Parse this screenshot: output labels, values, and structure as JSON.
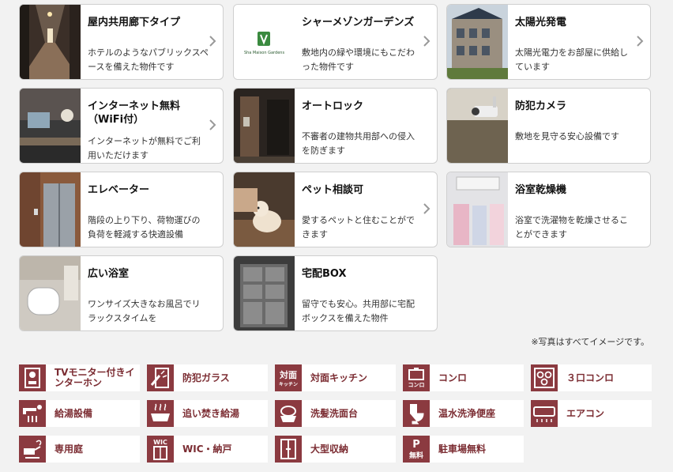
{
  "cards": [
    {
      "title": "屋内共用廊下タイプ",
      "desc": "ホテルのようなパブリックスペースを備えた物件です",
      "icon": "hallway-photo",
      "has_link": true
    },
    {
      "title": "シャーメゾンガーデンズ",
      "desc": "敷地内の緑や環境にもこだわった物件です",
      "icon": "shamaison-gardens-logo",
      "logo_text": "Sha Maison Gardens",
      "has_link": true
    },
    {
      "title": "太陽光発電",
      "desc": "太陽光電力をお部屋に供給しています",
      "icon": "solar-building-photo",
      "has_link": true
    },
    {
      "title": "インターネット無料（WiFi付）",
      "desc": "インターネットが無料でご利用いただけます",
      "icon": "lounge-photo",
      "has_link": true
    },
    {
      "title": "オートロック",
      "desc": "不審者の建物共用部への侵入を防ぎます",
      "icon": "entrance-photo",
      "has_link": false
    },
    {
      "title": "防犯カメラ",
      "desc": "敷地を見守る安心設備です",
      "icon": "security-camera-photo",
      "has_link": false
    },
    {
      "title": "エレベーター",
      "desc": "階段の上り下り、荷物運びの負荷を軽減する快適設備",
      "icon": "elevator-photo",
      "has_link": false
    },
    {
      "title": "ペット相談可",
      "desc": "愛するペットと住むことができます",
      "icon": "pet-dog-photo",
      "has_link": true
    },
    {
      "title": "浴室乾燥機",
      "desc": "浴室で洗濯物を乾燥させることができます",
      "icon": "bathroom-dryer-photo",
      "has_link": false
    },
    {
      "title": "広い浴室",
      "desc": "ワンサイズ大きなお風呂でリラックスタイムを",
      "icon": "bathtub-photo",
      "has_link": false
    },
    {
      "title": "宅配BOX",
      "desc": "留守でも安心。共用部に宅配ボックスを備えた物件",
      "icon": "delivery-box-photo",
      "has_link": false
    }
  ],
  "note": "※写真はすべてイメージです。",
  "amenities": [
    {
      "label": "TVモニター付きインターホン",
      "icon": "intercom-icon"
    },
    {
      "label": "防犯ガラス",
      "icon": "security-glass-icon"
    },
    {
      "label": "対面キッチン",
      "icon": "counter-kitchen-icon",
      "icon_text": [
        "対面",
        "キッチン"
      ]
    },
    {
      "label": "コンロ",
      "icon": "stove-icon",
      "icon_text": [
        "コンロ"
      ]
    },
    {
      "label": "３口コンロ",
      "icon": "three-burner-icon"
    },
    {
      "label": "給湯設備",
      "icon": "water-heater-icon"
    },
    {
      "label": "追い焚き給湯",
      "icon": "reheat-bath-icon"
    },
    {
      "label": "洗髪洗面台",
      "icon": "washbasin-icon"
    },
    {
      "label": "温水洗浄便座",
      "icon": "toilet-icon"
    },
    {
      "label": "エアコン",
      "icon": "air-conditioner-icon"
    },
    {
      "label": "専用庭",
      "icon": "private-garden-icon"
    },
    {
      "label": "WIC・納戸",
      "icon": "walk-in-closet-icon",
      "icon_text": [
        "WIC"
      ]
    },
    {
      "label": "大型収納",
      "icon": "large-storage-icon"
    },
    {
      "label": "駐車場無料",
      "icon": "free-parking-icon",
      "icon_text": [
        "P",
        "無料"
      ]
    }
  ],
  "colors": {
    "accent": "#8b3a40",
    "label": "#7b2c32",
    "border": "#cfcfcf",
    "background": "#f2f2f2"
  }
}
